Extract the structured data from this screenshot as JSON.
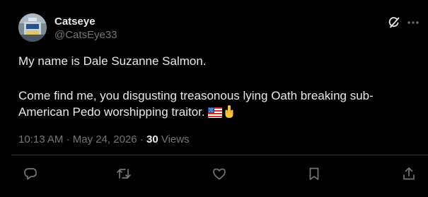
{
  "author": {
    "display_name": "Catseye",
    "handle": "@CatsEye33"
  },
  "post": {
    "line1": "My name is Dale Suzanne Salmon.",
    "line2": "Come find me, you disgusting treasonous lying Oath breaking sub-",
    "line3": "American Pedo worshipping traitor.",
    "emojis": [
      "us-flag-emoji",
      "middle-finger-emoji"
    ]
  },
  "meta": {
    "time": "10:13 AM",
    "separator": "·",
    "date": "May 24, 2026",
    "views_count": "30",
    "views_label": "Views"
  },
  "icons": {
    "header": [
      "grok-icon",
      "more-icon"
    ],
    "actions": [
      "reply-icon",
      "repost-icon",
      "like-icon",
      "bookmark-icon",
      "share-icon"
    ]
  },
  "colors": {
    "background": "#000000",
    "text_primary": "#e7e9ea",
    "text_secondary": "#71767b",
    "divider": "#2f3336"
  }
}
